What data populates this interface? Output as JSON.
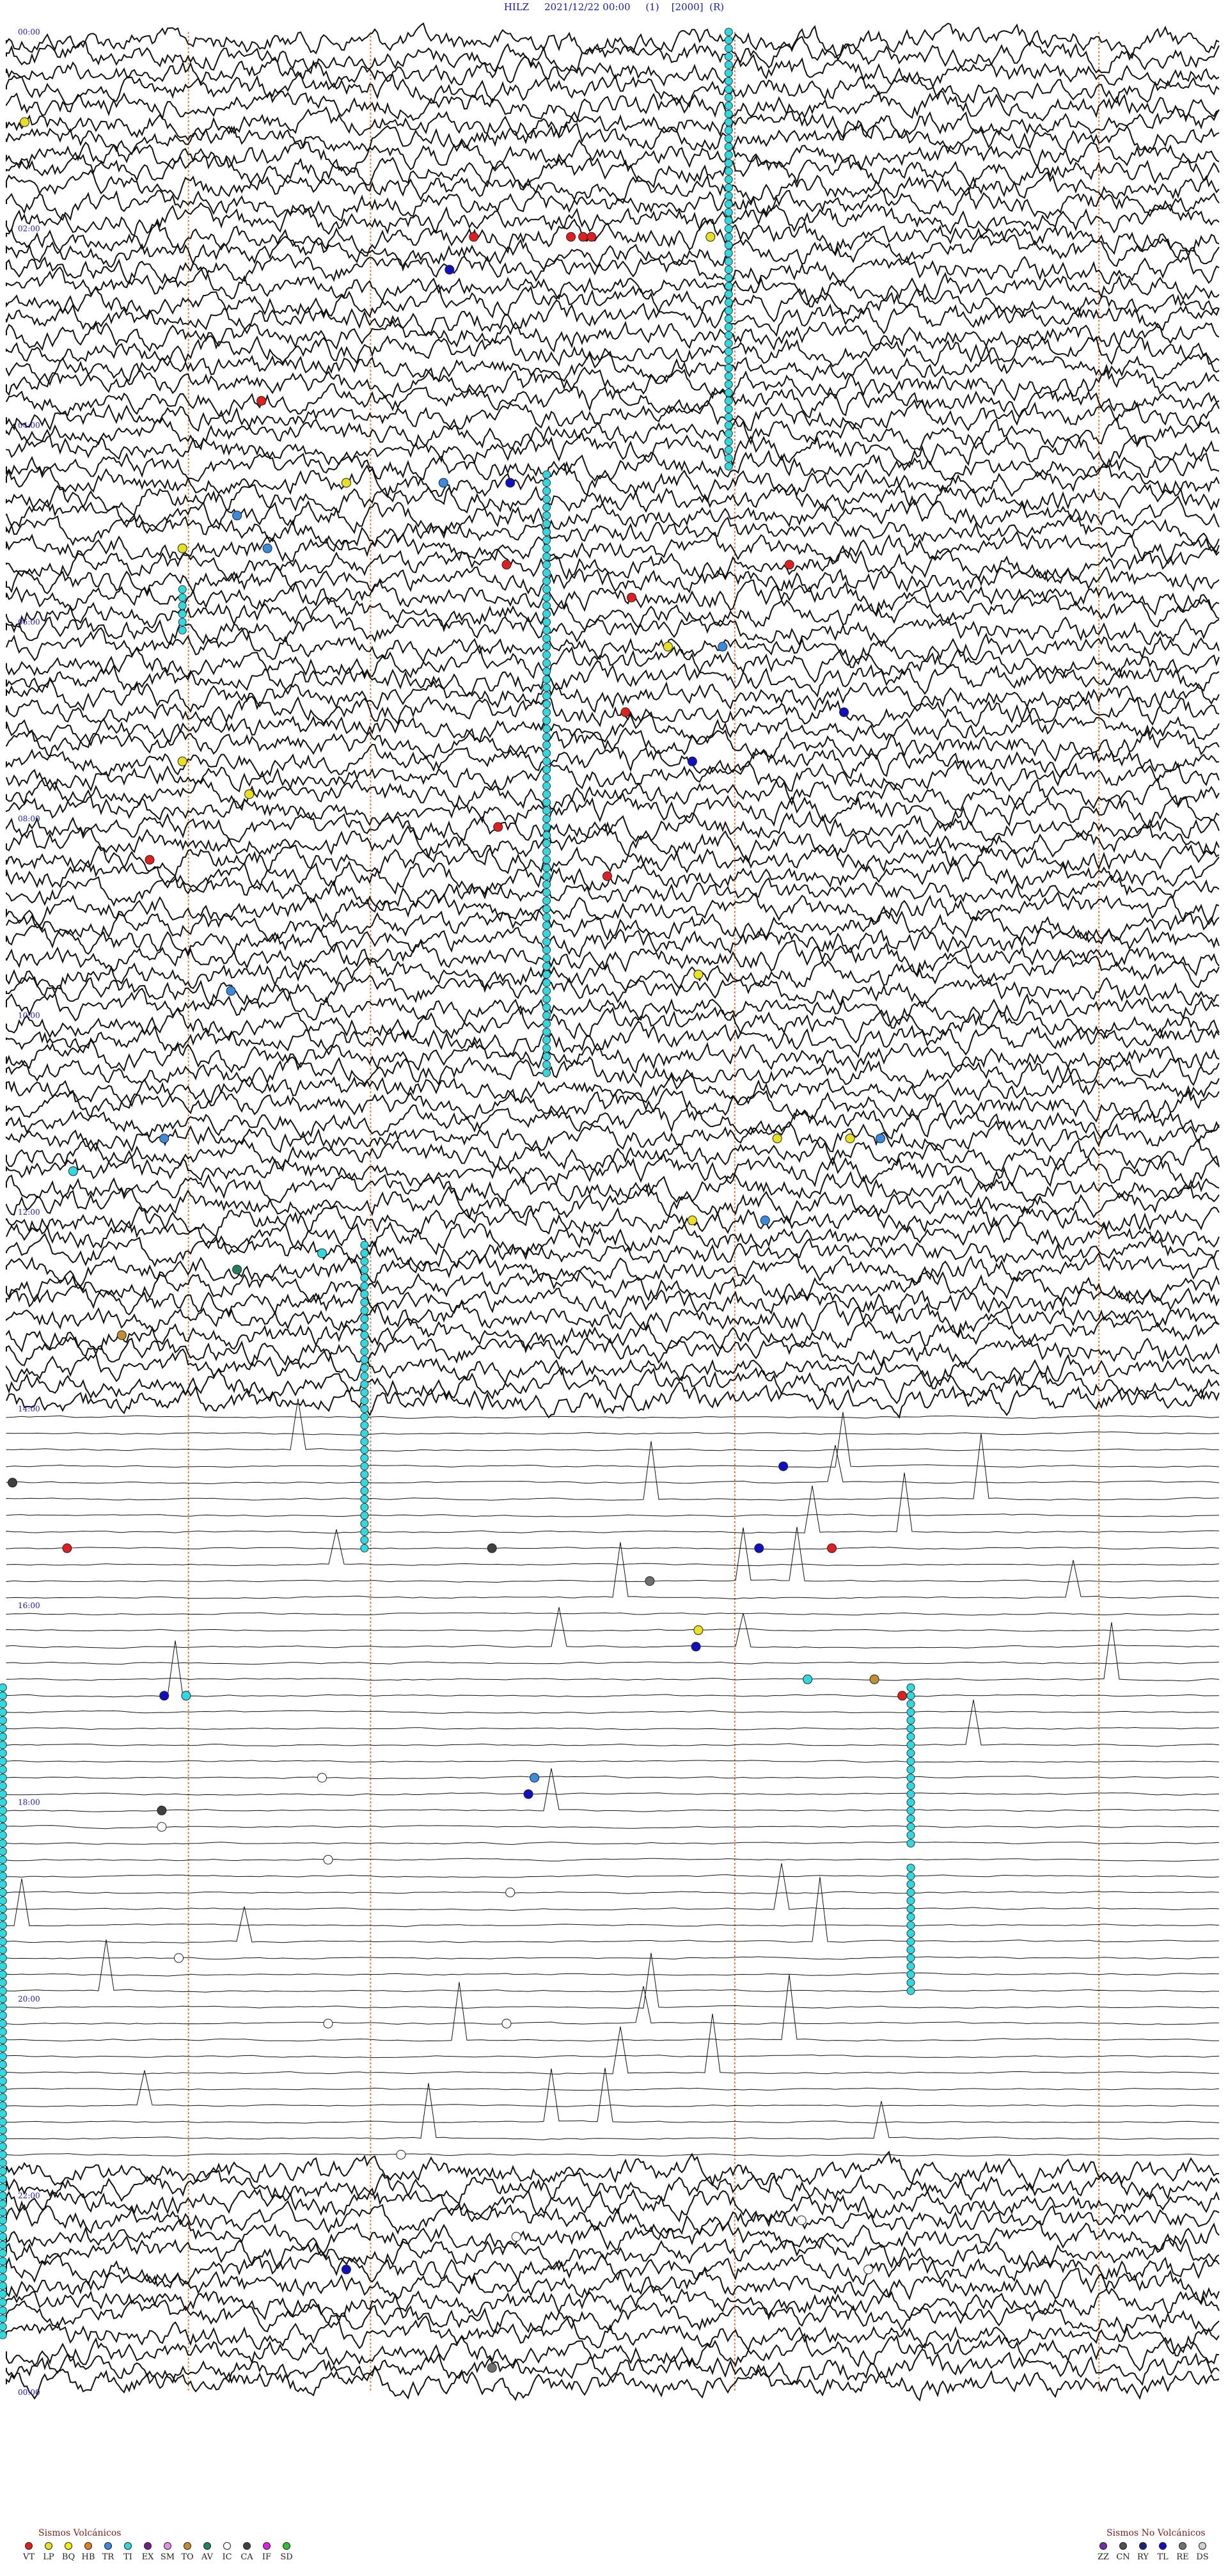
{
  "header": {
    "station": "HILZ",
    "datetime": "2021/12/22 00:00",
    "flag1": "(1)",
    "gain": "[2000]",
    "flag2": "(R)"
  },
  "chart_data": {
    "type": "line",
    "description_units": "helicorder: rows are consecutive time windows, x = minutes within row",
    "rows": 144,
    "row_minutes": 10,
    "hour_labels": [
      "00:00",
      "02:00",
      "04:00",
      "06:00",
      "08:00",
      "10:00",
      "12:00",
      "14:00",
      "16:00",
      "18:00",
      "20:00",
      "22:00",
      "00:00"
    ],
    "activity_segments": [
      {
        "rows": [
          0,
          84
        ],
        "level": "high"
      },
      {
        "rows": [
          84,
          130
        ],
        "level": "quiet"
      },
      {
        "rows": [
          130,
          144
        ],
        "level": "high"
      }
    ],
    "minute_markers": [
      1.5,
      3,
      6,
      9,
      12.0
    ],
    "marker_color": "#e87a3a",
    "trace_color": "#111111",
    "event_colors": {
      "VT": "#e02020",
      "LP": "#e8e020",
      "BQ": "#f0f000",
      "HB": "#e08020",
      "TR": "#3a8ae0",
      "TI": "#30d8e0",
      "EX": "#702080",
      "SM": "#e090e0",
      "TO": "#c09030",
      "AV": "#208060",
      "IC": "#ffffff",
      "CA": "#404040",
      "IF": "#e020e0",
      "SD": "#30c030",
      "ZZ": "#7030a0",
      "CN": "#505050",
      "RY": "#202080",
      "TL": "#1010c0",
      "RE": "#707070",
      "DS": "#d0d0d0"
    },
    "events": [
      {
        "row": 5,
        "min": 0.15,
        "type": "LP"
      },
      {
        "row": 12,
        "min": 3.85,
        "type": "VT"
      },
      {
        "row": 12,
        "min": 4.65,
        "type": "VT"
      },
      {
        "row": 12,
        "min": 4.75,
        "type": "VT"
      },
      {
        "row": 12,
        "min": 4.82,
        "type": "VT"
      },
      {
        "row": 12,
        "min": 5.8,
        "type": "LP"
      },
      {
        "row": 14,
        "min": 3.65,
        "type": "TL"
      },
      {
        "row": 22,
        "min": 2.1,
        "type": "VT"
      },
      {
        "row": 27,
        "min": 2.8,
        "type": "LP"
      },
      {
        "row": 27,
        "min": 3.6,
        "type": "TR"
      },
      {
        "row": 27,
        "min": 4.15,
        "type": "TL"
      },
      {
        "row": 29,
        "min": 1.9,
        "type": "TR"
      },
      {
        "row": 31,
        "min": 1.45,
        "type": "LP"
      },
      {
        "row": 31,
        "min": 2.15,
        "type": "TR"
      },
      {
        "row": 32,
        "min": 6.45,
        "type": "VT"
      },
      {
        "row": 32,
        "min": 4.12,
        "type": "VT"
      },
      {
        "row": 34,
        "min": 5.15,
        "type": "VT"
      },
      {
        "row": 37,
        "min": 5.45,
        "type": "LP"
      },
      {
        "row": 37,
        "min": 5.9,
        "type": "TR"
      },
      {
        "row": 41,
        "min": 5.1,
        "type": "VT"
      },
      {
        "row": 41,
        "min": 6.9,
        "type": "TL"
      },
      {
        "row": 44,
        "min": 1.45,
        "type": "LP"
      },
      {
        "row": 44,
        "min": 5.65,
        "type": "TL"
      },
      {
        "row": 46,
        "min": 2.0,
        "type": "LP"
      },
      {
        "row": 48,
        "min": 4.05,
        "type": "VT"
      },
      {
        "row": 50,
        "min": 1.18,
        "type": "VT"
      },
      {
        "row": 51,
        "min": 4.95,
        "type": "VT"
      },
      {
        "row": 57,
        "min": 5.7,
        "type": "LP"
      },
      {
        "row": 58,
        "min": 1.85,
        "type": "TR"
      },
      {
        "row": 67,
        "min": 1.3,
        "type": "TR"
      },
      {
        "row": 67,
        "min": 6.35,
        "type": "LP"
      },
      {
        "row": 67,
        "min": 6.95,
        "type": "LP"
      },
      {
        "row": 67,
        "min": 7.2,
        "type": "TR"
      },
      {
        "row": 69,
        "min": 0.55,
        "type": "TI"
      },
      {
        "row": 72,
        "min": 5.65,
        "type": "LP"
      },
      {
        "row": 72,
        "min": 6.25,
        "type": "TR"
      },
      {
        "row": 74,
        "min": 2.6,
        "type": "TI"
      },
      {
        "row": 75,
        "min": 1.9,
        "type": "AV"
      },
      {
        "row": 79,
        "min": 0.95,
        "type": "TO"
      },
      {
        "row": 87,
        "min": 6.4,
        "type": "TL"
      },
      {
        "row": 88,
        "min": 0.05,
        "type": "CA"
      },
      {
        "row": 92,
        "min": 0.5,
        "type": "VT"
      },
      {
        "row": 92,
        "min": 4.0,
        "type": "CA"
      },
      {
        "row": 92,
        "min": 6.2,
        "type": "TL"
      },
      {
        "row": 92,
        "min": 6.8,
        "type": "VT"
      },
      {
        "row": 94,
        "min": 5.3,
        "type": "RE"
      },
      {
        "row": 97,
        "min": 5.7,
        "type": "LP"
      },
      {
        "row": 98,
        "min": 5.68,
        "type": "TL"
      },
      {
        "row": 100,
        "min": 6.6,
        "type": "TI"
      },
      {
        "row": 100,
        "min": 7.15,
        "type": "TO"
      },
      {
        "row": 101,
        "min": 1.3,
        "type": "TL"
      },
      {
        "row": 101,
        "min": 1.48,
        "type": "TI"
      },
      {
        "row": 101,
        "min": 7.38,
        "type": "VT"
      },
      {
        "row": 106,
        "min": 2.6,
        "type": "IC"
      },
      {
        "row": 106,
        "min": 4.35,
        "type": "TR"
      },
      {
        "row": 107,
        "min": 4.3,
        "type": "TL"
      },
      {
        "row": 108,
        "min": 1.28,
        "type": "CA"
      },
      {
        "row": 109,
        "min": 1.28,
        "type": "IC"
      },
      {
        "row": 111,
        "min": 2.65,
        "type": "IC"
      },
      {
        "row": 113,
        "min": 4.15,
        "type": "IC"
      },
      {
        "row": 117,
        "min": 1.42,
        "type": "IC"
      },
      {
        "row": 121,
        "min": 2.65,
        "type": "IC"
      },
      {
        "row": 121,
        "min": 4.12,
        "type": "IC"
      },
      {
        "row": 129,
        "min": 3.25,
        "type": "IC"
      },
      {
        "row": 133,
        "min": 6.55,
        "type": "IC"
      },
      {
        "row": 134,
        "min": 4.2,
        "type": "IC"
      },
      {
        "row": 136,
        "min": 2.8,
        "type": "TL"
      },
      {
        "row": 136,
        "min": 7.1,
        "type": "IC"
      },
      {
        "row": 142,
        "min": 4.0,
        "type": "RE"
      }
    ],
    "ti_columns": [
      {
        "min": 5.95,
        "rows": [
          0,
          26
        ]
      },
      {
        "min": 4.45,
        "rows": [
          27,
          63
        ]
      },
      {
        "min": 2.95,
        "rows": [
          74,
          92
        ]
      },
      {
        "min": 1.45,
        "rows": [
          34,
          36
        ]
      },
      {
        "min": 7.45,
        "rows": [
          101,
          110
        ]
      },
      {
        "min": -0.03,
        "rows": [
          101,
          140
        ]
      },
      {
        "min": 7.45,
        "rows": [
          112,
          119
        ]
      }
    ]
  },
  "legend_volcanic": {
    "title": "Sismos Volcánicos",
    "items": [
      {
        "code": "VT",
        "color": "#e02020"
      },
      {
        "code": "LP",
        "color": "#e8e020"
      },
      {
        "code": "BQ",
        "color": "#f0f000"
      },
      {
        "code": "HB",
        "color": "#e08020"
      },
      {
        "code": "TR",
        "color": "#3a8ae0"
      },
      {
        "code": "TI",
        "color": "#30d8e0"
      },
      {
        "code": "EX",
        "color": "#702080"
      },
      {
        "code": "SM",
        "color": "#e090e0"
      },
      {
        "code": "TO",
        "color": "#c09030"
      },
      {
        "code": "AV",
        "color": "#208060"
      },
      {
        "code": "IC",
        "color": "#ffffff"
      },
      {
        "code": "CA",
        "color": "#404040"
      },
      {
        "code": "IF",
        "color": "#e020e0"
      },
      {
        "code": "SD",
        "color": "#30c030"
      }
    ]
  },
  "legend_nonvolcanic": {
    "title": "Sismos No Volcánicos",
    "items": [
      {
        "code": "ZZ",
        "color": "#7030a0"
      },
      {
        "code": "CN",
        "color": "#505050"
      },
      {
        "code": "RY",
        "color": "#202080"
      },
      {
        "code": "TL",
        "color": "#1010c0"
      },
      {
        "code": "RE",
        "color": "#707070"
      },
      {
        "code": "DS",
        "color": "#d0d0d0"
      }
    ]
  }
}
